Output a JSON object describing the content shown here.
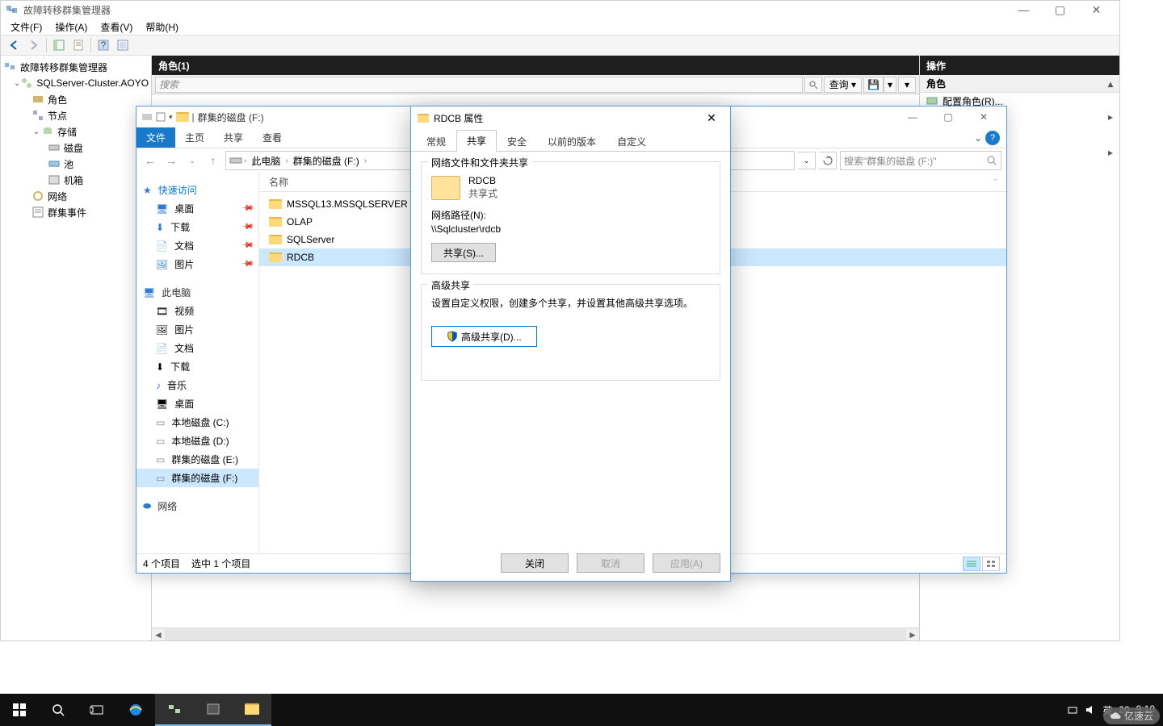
{
  "main": {
    "title": "故障转移群集管理器",
    "menus": [
      "文件(F)",
      "操作(A)",
      "查看(V)",
      "帮助(H)"
    ],
    "tree": {
      "root": "故障转移群集管理器",
      "cluster": "SQLServer-Cluster.AOYO",
      "roles": "角色",
      "nodes": "节点",
      "storage": "存储",
      "disks": "磁盘",
      "pools": "池",
      "enclosures": "机箱",
      "networks": "网络",
      "events": "群集事件"
    },
    "mid_header": "角色(1)",
    "search_placeholder": "搜索",
    "query_label": "查询",
    "save_icon": "💾",
    "actions_header": "操作",
    "actions_sub": "角色",
    "actions_item": "配置角色(R)..."
  },
  "explorer": {
    "drive_label": "群集的磁盘 (F:)",
    "ribbon": {
      "file": "文件",
      "home": "主页",
      "share": "共享",
      "view": "查看"
    },
    "crumb": {
      "pc": "此电脑",
      "drive": "群集的磁盘 (F:)"
    },
    "search_placeholder": "搜索\"群集的磁盘 (F:)\"",
    "nav": {
      "quick": "快速访问",
      "quick_items": [
        "桌面",
        "下载",
        "文档",
        "图片"
      ],
      "thispc": "此电脑",
      "pc_items": [
        "视频",
        "图片",
        "文档",
        "下载",
        "音乐",
        "桌面",
        "本地磁盘 (C:)",
        "本地磁盘 (D:)",
        "群集的磁盘 (E:)",
        "群集的磁盘 (F:)"
      ],
      "network": "网络"
    },
    "col_name": "名称",
    "files": [
      "MSSQL13.MSSQLSERVER",
      "OLAP",
      "SQLServer",
      "RDCB"
    ],
    "status_count": "4 个项目",
    "status_sel": "选中 1 个项目"
  },
  "props": {
    "title": "RDCB 属性",
    "tabs": [
      "常规",
      "共享",
      "安全",
      "以前的版本",
      "自定义"
    ],
    "group1_legend": "网络文件和文件夹共享",
    "folder_name": "RDCB",
    "share_mode": "共享式",
    "path_label": "网络路径(N):",
    "path_value": "\\\\Sqlcluster\\rdcb",
    "share_btn": "共享(S)...",
    "group2_legend": "高级共享",
    "adv_desc": "设置自定义权限，创建多个共享，并设置其他高级共享选项。",
    "adv_btn": "高级共享(D)...",
    "btn_close": "关闭",
    "btn_cancel": "取消",
    "btn_apply": "应用(A)"
  },
  "taskbar": {
    "ime": "英",
    "date_part": "20",
    "time": "9:10"
  },
  "watermark": "亿速云"
}
